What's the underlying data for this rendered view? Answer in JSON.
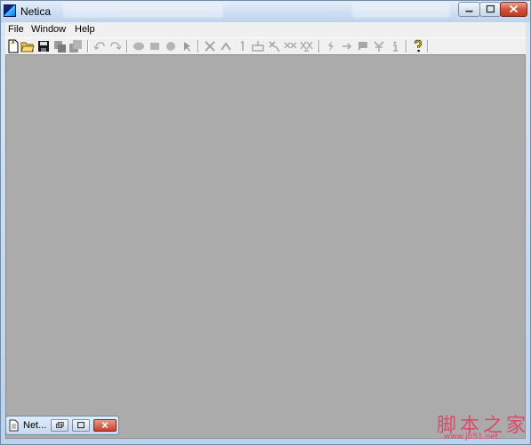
{
  "window": {
    "title": "Netica",
    "icon": "netica-app-icon",
    "controls": [
      "minimize-icon",
      "maximize-icon",
      "close-icon"
    ]
  },
  "menubar": {
    "items": [
      {
        "label": "File"
      },
      {
        "label": "Window"
      },
      {
        "label": "Help"
      }
    ]
  },
  "toolbar": {
    "groups": [
      [
        "new-document-icon",
        "open-folder-icon",
        "save-disk-icon",
        "print-icon",
        "save-all-icon"
      ],
      [
        "undo-icon",
        "redo-icon"
      ],
      [
        "ellipse-node-icon",
        "rectangle-node-icon",
        "circle-node-icon",
        "select-arrow-icon"
      ],
      [
        "decision-tool-icon",
        "utility-tool-icon",
        "text-1-icon",
        "compile-icon",
        "absorb-icon",
        "reverse-icon",
        "remove-icon"
      ],
      [
        "lightning-icon",
        "arrow-right-icon",
        "flag-icon",
        "pin-icon",
        "info-icon"
      ],
      [
        "help-question-icon"
      ]
    ]
  },
  "minimized_child": {
    "label": "Net...",
    "icon": "document-icon",
    "controls": [
      "restore-icon",
      "maximize-icon",
      "close-icon"
    ]
  },
  "watermark": {
    "text": "脚本之家",
    "sub": "www.jb51.net"
  },
  "colors": {
    "workspace": "#ababab",
    "titlebar": "#c7daef",
    "close_button": "#c7402a",
    "toolbar": "#f0f0f0"
  }
}
